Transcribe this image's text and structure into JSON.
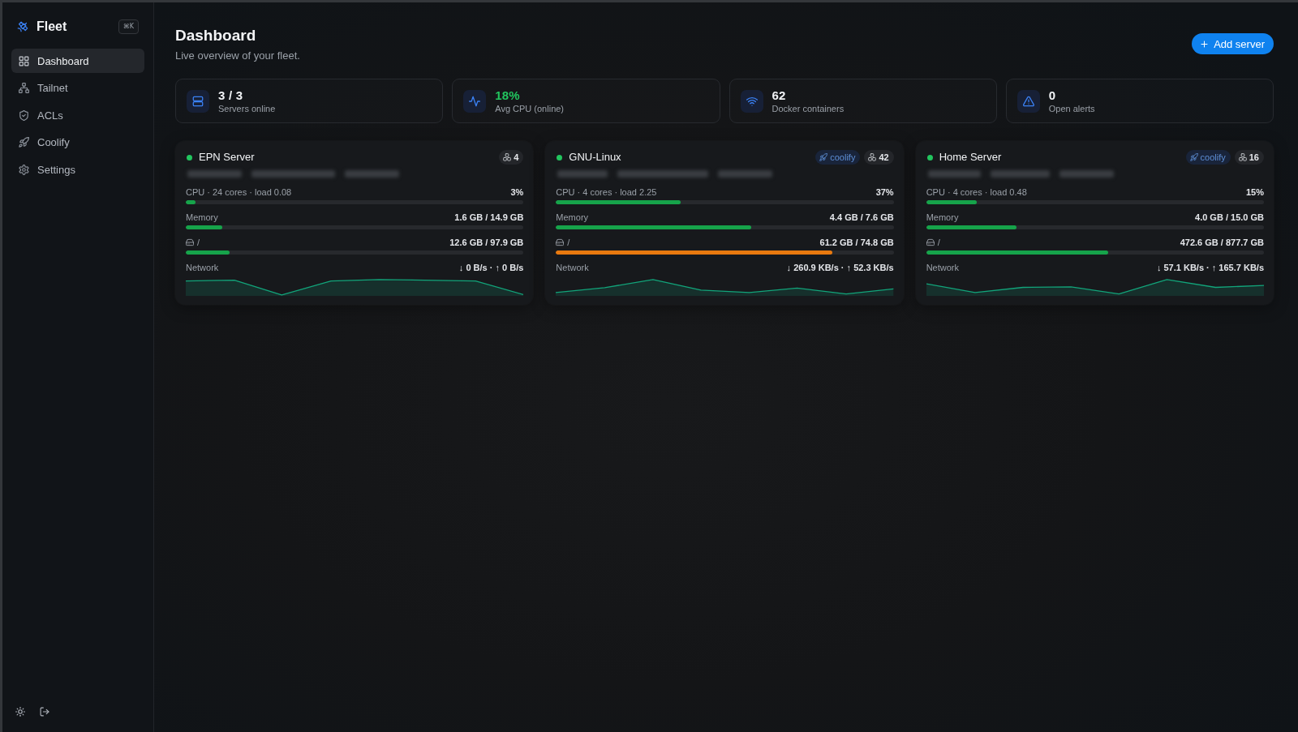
{
  "sidebar": {
    "brand": "Fleet",
    "shortcut": "⌘K",
    "items": [
      {
        "label": "Dashboard",
        "selected": true
      },
      {
        "label": "Tailnet",
        "selected": false
      },
      {
        "label": "ACLs",
        "selected": false
      },
      {
        "label": "Coolify",
        "selected": false
      },
      {
        "label": "Settings",
        "selected": false
      }
    ]
  },
  "header": {
    "title": "Dashboard",
    "subtitle": "Live overview of your fleet.",
    "action": "Add server"
  },
  "stats": [
    {
      "kind": "servers",
      "value": "3 / 3",
      "label": "Servers online",
      "highlighted": false
    },
    {
      "kind": "cpu",
      "value": "18%",
      "label": "Avg CPU (online)",
      "highlighted": true
    },
    {
      "kind": "containers",
      "value": "62",
      "label": "Docker containers",
      "highlighted": false
    },
    {
      "kind": "alerts",
      "value": "0",
      "label": "Open alerts",
      "highlighted": false
    }
  ],
  "servers": [
    {
      "name": "EPN Server",
      "online": true,
      "details_blurred": true,
      "badges": [
        {
          "kind": "containers",
          "label": "4"
        }
      ],
      "metrics": [
        {
          "kind": "cpu",
          "label": "CPU · 24 cores · load 0.08",
          "reading": "3%",
          "level": 0.03,
          "color": "#16a34a"
        },
        {
          "kind": "memory",
          "label": "Memory",
          "reading": "1.6 GB / 14.9 GB",
          "level": 0.107,
          "color": "#16a34a"
        },
        {
          "kind": "disk",
          "label": "/",
          "reading": "12.6 GB / 97.9 GB",
          "level": 0.129,
          "color": "#16a34a"
        }
      ],
      "network": {
        "label": "Network",
        "reading": "↓ 0 B/s · ↑ 0 B/s"
      }
    },
    {
      "name": "GNU-Linux",
      "online": true,
      "details_blurred": true,
      "badges": [
        {
          "kind": "coolify",
          "label": "coolify"
        },
        {
          "kind": "containers",
          "label": "42"
        }
      ],
      "metrics": [
        {
          "kind": "cpu",
          "label": "CPU · 4 cores · load 2.25",
          "reading": "37%",
          "level": 0.37,
          "color": "#16a34a"
        },
        {
          "kind": "memory",
          "label": "Memory",
          "reading": "4.4 GB / 7.6 GB",
          "level": 0.579,
          "color": "#16a34a"
        },
        {
          "kind": "disk",
          "label": "/",
          "reading": "61.2 GB / 74.8 GB",
          "level": 0.818,
          "color": "#e8790f"
        }
      ],
      "network": {
        "label": "Network",
        "reading": "↓ 260.9 KB/s · ↑ 52.3 KB/s"
      }
    },
    {
      "name": "Home Server",
      "online": true,
      "details_blurred": true,
      "badges": [
        {
          "kind": "coolify",
          "label": "coolify"
        },
        {
          "kind": "containers",
          "label": "16"
        }
      ],
      "metrics": [
        {
          "kind": "cpu",
          "label": "CPU · 4 cores · load 0.48",
          "reading": "15%",
          "level": 0.15,
          "color": "#16a34a"
        },
        {
          "kind": "memory",
          "label": "Memory",
          "reading": "4.0 GB / 15.0 GB",
          "level": 0.267,
          "color": "#16a34a"
        },
        {
          "kind": "disk",
          "label": "/",
          "reading": "472.6 GB / 877.7 GB",
          "level": 0.538,
          "color": "#16a34a"
        }
      ],
      "network": {
        "label": "Network",
        "reading": "↓ 57.1 KB/s · ↑ 165.7 KB/s"
      }
    }
  ]
}
